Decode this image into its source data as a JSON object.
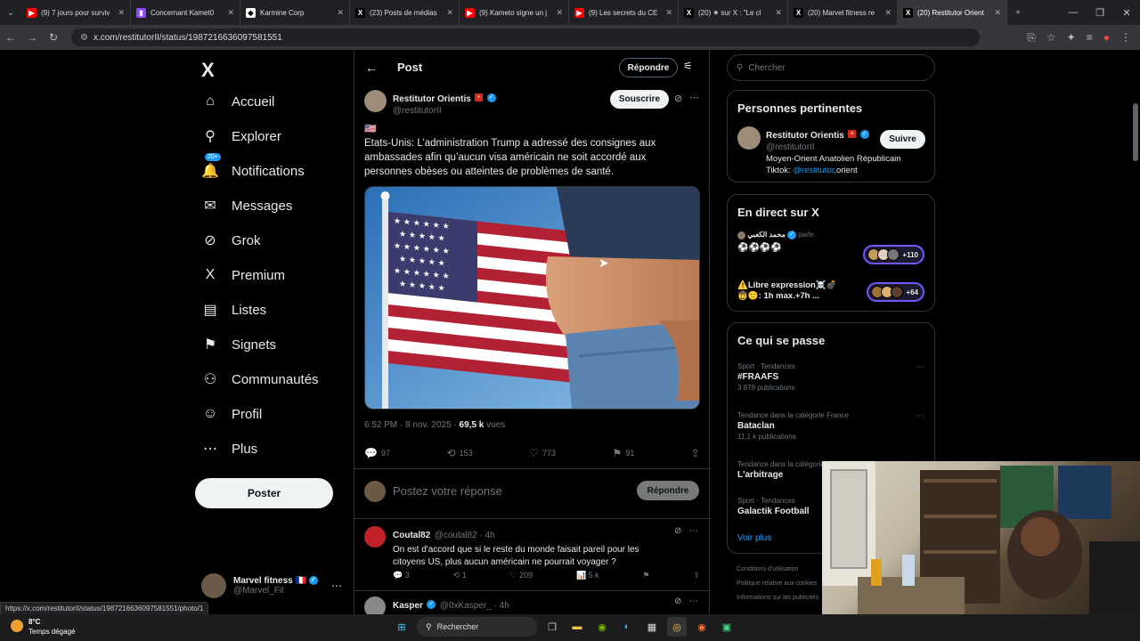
{
  "browser": {
    "tabs": [
      {
        "title": "(9) 7 jours pour surviv",
        "color": "#ff0000",
        "glyph": "▶"
      },
      {
        "title": "Concernant Kamet0",
        "color": "#9146ff",
        "glyph": "▮"
      },
      {
        "title": "Karmine Corp",
        "color": "#ffffff",
        "glyph": "◆"
      },
      {
        "title": "(23) Posts de médias",
        "color": "#000000",
        "glyph": "X"
      },
      {
        "title": "(9) Kameto signe un j",
        "color": "#ff0000",
        "glyph": "▶"
      },
      {
        "title": "(9) Les secrets du CE",
        "color": "#ff0000",
        "glyph": "▶"
      },
      {
        "title": "(20) ✷ sur X : \"Le cl",
        "color": "#000000",
        "glyph": "X"
      },
      {
        "title": "(20) Marvel fitness re",
        "color": "#000000",
        "glyph": "X"
      },
      {
        "title": "(20) Restitutor Orient",
        "color": "#000000",
        "glyph": "X"
      }
    ],
    "new_tab": "+",
    "url": "x.com/restitutorII/status/1987216636097581551",
    "status_url": "https://x.com/restitutorII/status/1987216636097581551/photo/1"
  },
  "nav": {
    "logo": "X",
    "items": [
      {
        "label": "Accueil",
        "icon": "⌂",
        "name": "home"
      },
      {
        "label": "Explorer",
        "icon": "⚲",
        "name": "explore"
      },
      {
        "label": "Notifications",
        "icon": "🔔",
        "name": "notifications"
      },
      {
        "label": "Messages",
        "icon": "✉",
        "name": "messages"
      },
      {
        "label": "Grok",
        "icon": "⊘",
        "name": "grok"
      },
      {
        "label": "Premium",
        "icon": "X",
        "name": "premium"
      },
      {
        "label": "Listes",
        "icon": "▤",
        "name": "lists"
      },
      {
        "label": "Signets",
        "icon": "⚑",
        "name": "bookmarks"
      },
      {
        "label": "Communautés",
        "icon": "⚇",
        "name": "communities"
      },
      {
        "label": "Profil",
        "icon": "☺",
        "name": "profile"
      },
      {
        "label": "Plus",
        "icon": "⋯",
        "name": "more"
      }
    ],
    "notif_badge": "20+",
    "post_button": "Poster",
    "account": {
      "name": "Marvel fitness",
      "flag": "🇫🇷",
      "handle": "@Marvel_Fit",
      "more": "⋯"
    }
  },
  "main": {
    "title": "Post",
    "reply_button": "Répondre",
    "author": {
      "name": "Restitutor Orientis",
      "handle": "@restitutorII",
      "subscribe": "Souscrire"
    },
    "flag": "🇺🇸",
    "text": "Etats-Unis: L’administration Trump a adressé des consignes aux ambassades afin qu’aucun visa américain ne soit accordé aux personnes obèses ou atteintes de problèmes de santé.",
    "time": "6:52 PM · 8 nov. 2025 · ",
    "views_count": "69,5 k",
    "views_label": " vues",
    "stats": {
      "replies": "97",
      "reposts": "153",
      "likes": "773",
      "bookmarks": "91"
    },
    "reply_placeholder": "Postez votre réponse",
    "reply_submit": "Répondre",
    "comments": [
      {
        "name": "Coutal82",
        "handle": "@coutal82 · 4h",
        "text": "On est d'accord que si le reste du monde faisait pareil pour les citoyens US, plus aucun américain ne pourrait voyager ?",
        "replies": "3",
        "reposts": "1",
        "likes": "209",
        "views": "5 k"
      },
      {
        "name": "Kasper",
        "handle": "@0xKasper_ · 4h"
      }
    ]
  },
  "sidebar": {
    "search_placeholder": "Chercher",
    "relevant": {
      "title": "Personnes pertinentes",
      "name": "Restitutor Orientis",
      "handle": "@restitutorII",
      "follow": "Suivre",
      "bio1": "Moyen-Orient Anatolien Républicain",
      "bio2_prefix": "Tiktok: ",
      "bio2_link": "@restitutor",
      "bio2_suffix": ".orient"
    },
    "live": {
      "title": "En direct sur X",
      "host": "محمد الكعبي",
      "host_status": "parle.",
      "item1": "⚽⚽⚽⚽",
      "count1": "+110",
      "item2_line1": "⚠️Libre expression☠️💣",
      "item2_line2": "🤠🙂: 1h max.+7h ...",
      "count2": "+64"
    },
    "trends": {
      "title": "Ce qui se passe",
      "items": [
        {
          "category": "Sport · Tendances",
          "name": "#FRAAFS",
          "count": "3 979 publications"
        },
        {
          "category": "Tendance dans la catégorie France",
          "name": "Bataclan",
          "count": "11,1 k publications"
        },
        {
          "category": "Tendance dans la catégorie France",
          "name": "L'arbitrage",
          "count": ""
        },
        {
          "category": "Sport · Tendances",
          "name": "Galactik Football",
          "count": ""
        }
      ],
      "more": "Voir plus"
    },
    "footer": [
      "Conditions d'utilisation",
      "Politique relative aux cookies",
      "Informations sur les publicités"
    ]
  },
  "taskbar": {
    "temp": "8°C",
    "weather": "Temps dégagé",
    "search": "Rechercher"
  }
}
